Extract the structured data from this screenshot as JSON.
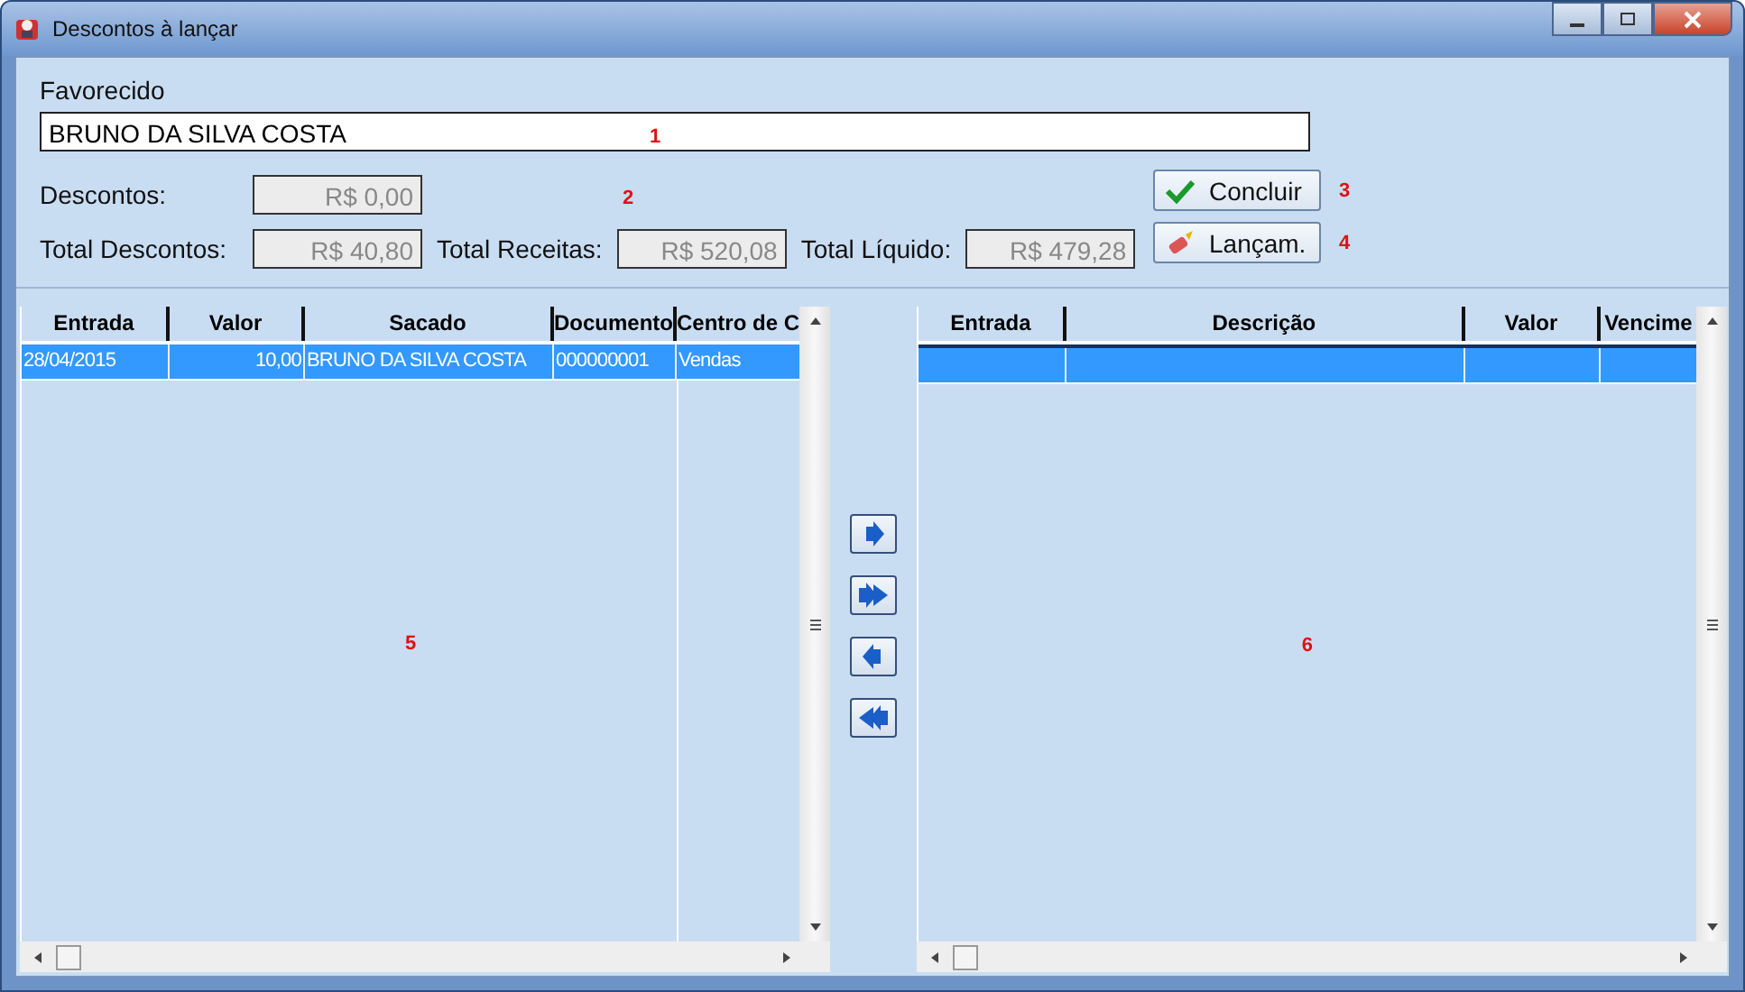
{
  "window": {
    "title": "Descontos à lançar"
  },
  "favorecido": {
    "label": "Favorecido",
    "value": "BRUNO DA SILVA COSTA",
    "marker": "1"
  },
  "descontos": {
    "label": "Descontos:",
    "value": "R$ 0,00",
    "marker": "2"
  },
  "totals": [
    {
      "label": "Total Descontos:",
      "value": "R$ 40,80"
    },
    {
      "label": "Total Receitas:",
      "value": "R$ 520,08"
    },
    {
      "label": "Total Líquido:",
      "value": "R$ 479,28"
    }
  ],
  "buttons": [
    {
      "kind": "check",
      "label": "Concluir",
      "marker": "3"
    },
    {
      "kind": "brush",
      "label": "Lançam.",
      "marker": "4"
    }
  ],
  "left_grid": {
    "marker": "5",
    "columns": [
      "Entrada",
      "Valor",
      "Sacado",
      "Documento",
      "Centro de C"
    ],
    "rows": [
      {
        "selected": true,
        "cells": [
          "28/04/2015",
          "10,00",
          "BRUNO DA SILVA COSTA",
          "000000001",
          "Vendas"
        ]
      }
    ]
  },
  "transfer_buttons": [
    {
      "kind": "one-right"
    },
    {
      "kind": "all-right"
    },
    {
      "kind": "one-left"
    },
    {
      "kind": "all-left"
    }
  ],
  "right_grid": {
    "marker": "6",
    "columns": [
      "Entrada",
      "Descrição",
      "Valor",
      "Vencime"
    ],
    "rows": [
      {
        "selected": true
      }
    ]
  }
}
